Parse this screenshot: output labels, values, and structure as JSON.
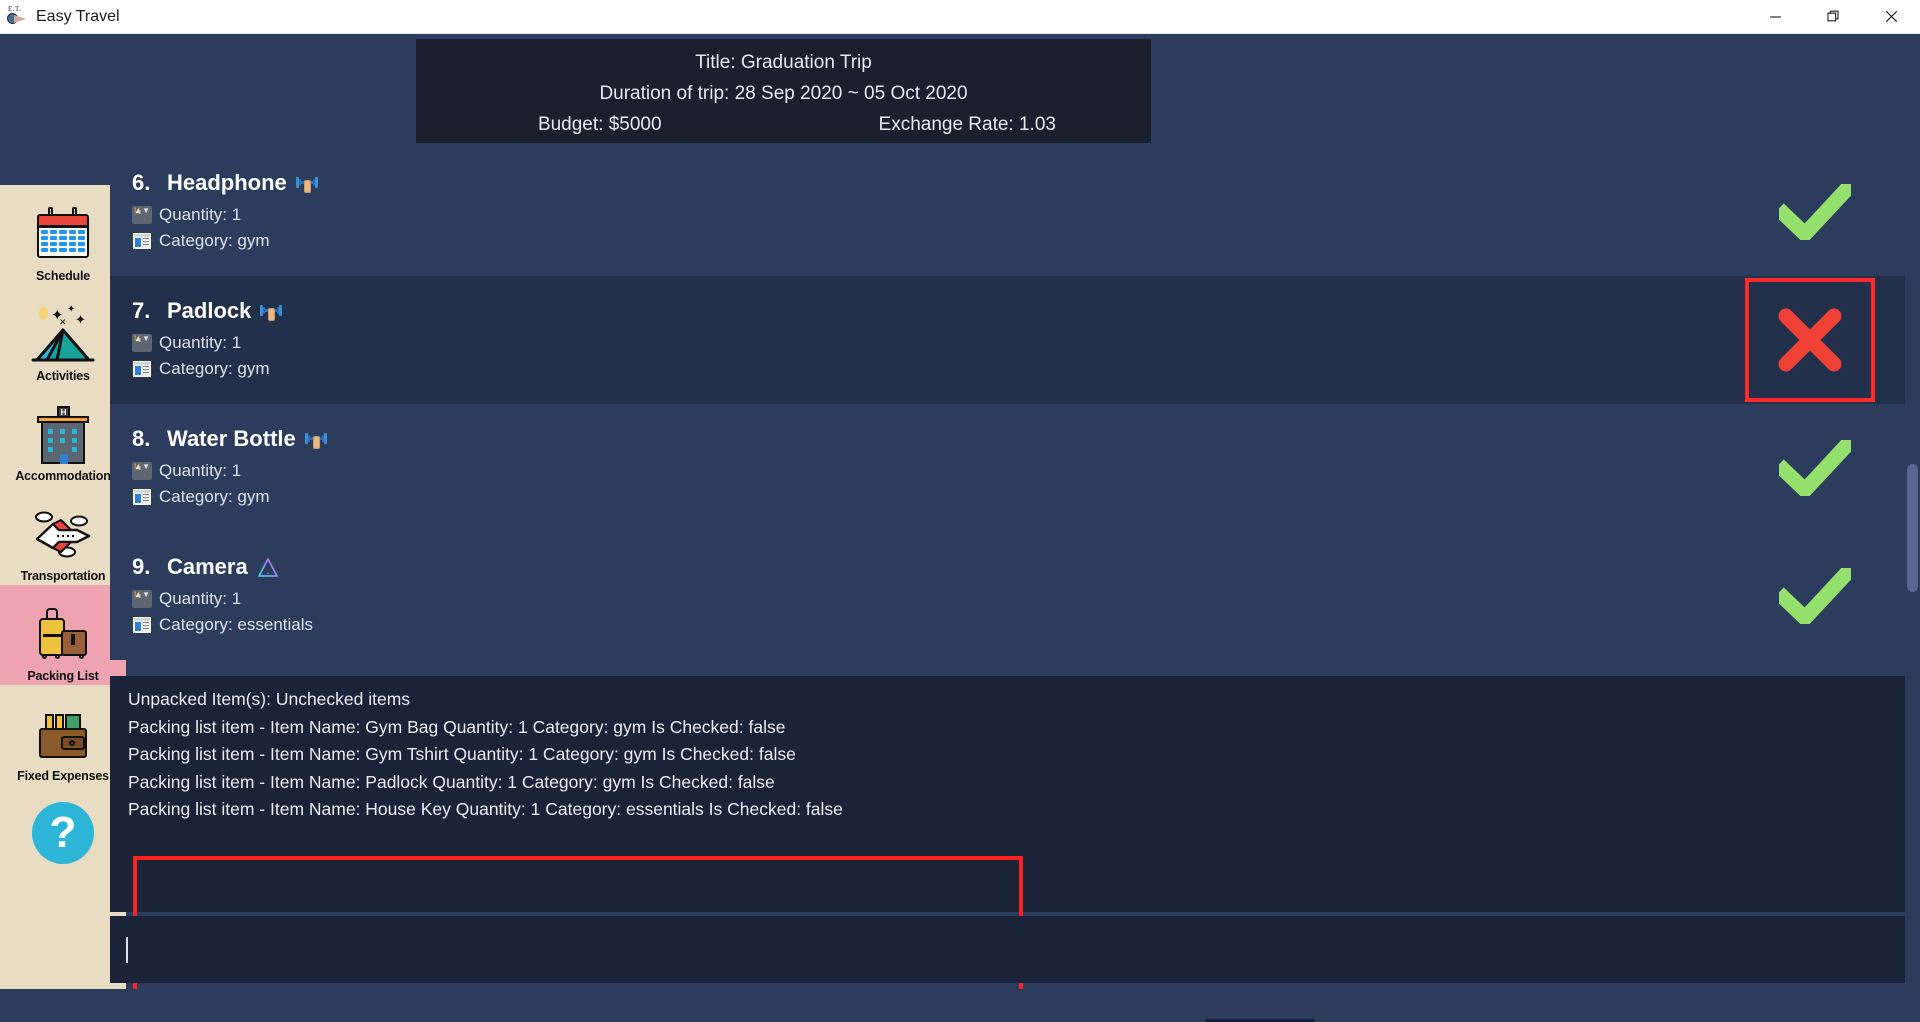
{
  "window": {
    "title": "Easy Travel",
    "icon": "app-logo-icon",
    "controls": {
      "minimize": "minimize-icon",
      "maximize": "restore-icon",
      "close": "close-icon"
    }
  },
  "trip_header": {
    "title_line": "Title: Graduation Trip",
    "duration_line": "Duration of trip: 28 Sep 2020 ~ 05 Oct 2020",
    "budget_line": "Budget: $5000",
    "exchange_line": "Exchange Rate: 1.03"
  },
  "sidebar": {
    "items": [
      {
        "label": "Schedule",
        "icon": "calendar-icon",
        "active": false
      },
      {
        "label": "Activities",
        "icon": "tent-icon",
        "active": false
      },
      {
        "label": "Accommodation",
        "icon": "hotel-icon",
        "active": false
      },
      {
        "label": "Transportation",
        "icon": "airplane-icon",
        "active": false
      },
      {
        "label": "Packing List",
        "icon": "luggage-icon",
        "active": true
      },
      {
        "label": "Fixed Expenses",
        "icon": "wallet-icon",
        "active": false
      }
    ],
    "help_label": "?"
  },
  "packing_list": {
    "items": [
      {
        "number": "6.",
        "name": "Headphone",
        "badge": "dumbbell-icon",
        "quantity_label": "Quantity: 1",
        "category_label": "Category: gym",
        "status": "checked"
      },
      {
        "number": "7.",
        "name": "Padlock",
        "badge": "dumbbell-icon",
        "quantity_label": "Quantity: 1",
        "category_label": "Category: gym",
        "status": "unchecked"
      },
      {
        "number": "8.",
        "name": "Water Bottle",
        "badge": "dumbbell-icon",
        "quantity_label": "Quantity: 1",
        "category_label": "Category: gym",
        "status": "checked"
      },
      {
        "number": "9.",
        "name": "Camera",
        "badge": "warning-triangle-icon",
        "quantity_label": "Quantity: 1",
        "category_label": "Category: essentials",
        "status": "checked"
      }
    ]
  },
  "log": {
    "lines": [
      "Unpacked Item(s): Unchecked items",
      "Packing list item - Item Name: Gym Bag Quantity: 1 Category: gym Is Checked: false",
      "Packing list item - Item Name: Gym Tshirt Quantity: 1 Category: gym Is Checked: false",
      "Packing list item - Item Name: Padlock Quantity: 1 Category: gym Is Checked: false",
      "Packing list item - Item Name: House Key Quantity: 1 Category: essentials Is Checked: false"
    ]
  },
  "command_input": {
    "value": "",
    "placeholder": ""
  },
  "colors": {
    "app_background": "#2b3c5c",
    "panel_dark": "#1b1f2e",
    "row_alt": "#22304b",
    "sidebar_background": "#e8dcc3",
    "sidebar_active": "#eea3b0",
    "check_green": "#95e06c",
    "cross_red": "#ef4136",
    "highlight_red": "#ff2020",
    "help_blue": "#2db6d8"
  }
}
